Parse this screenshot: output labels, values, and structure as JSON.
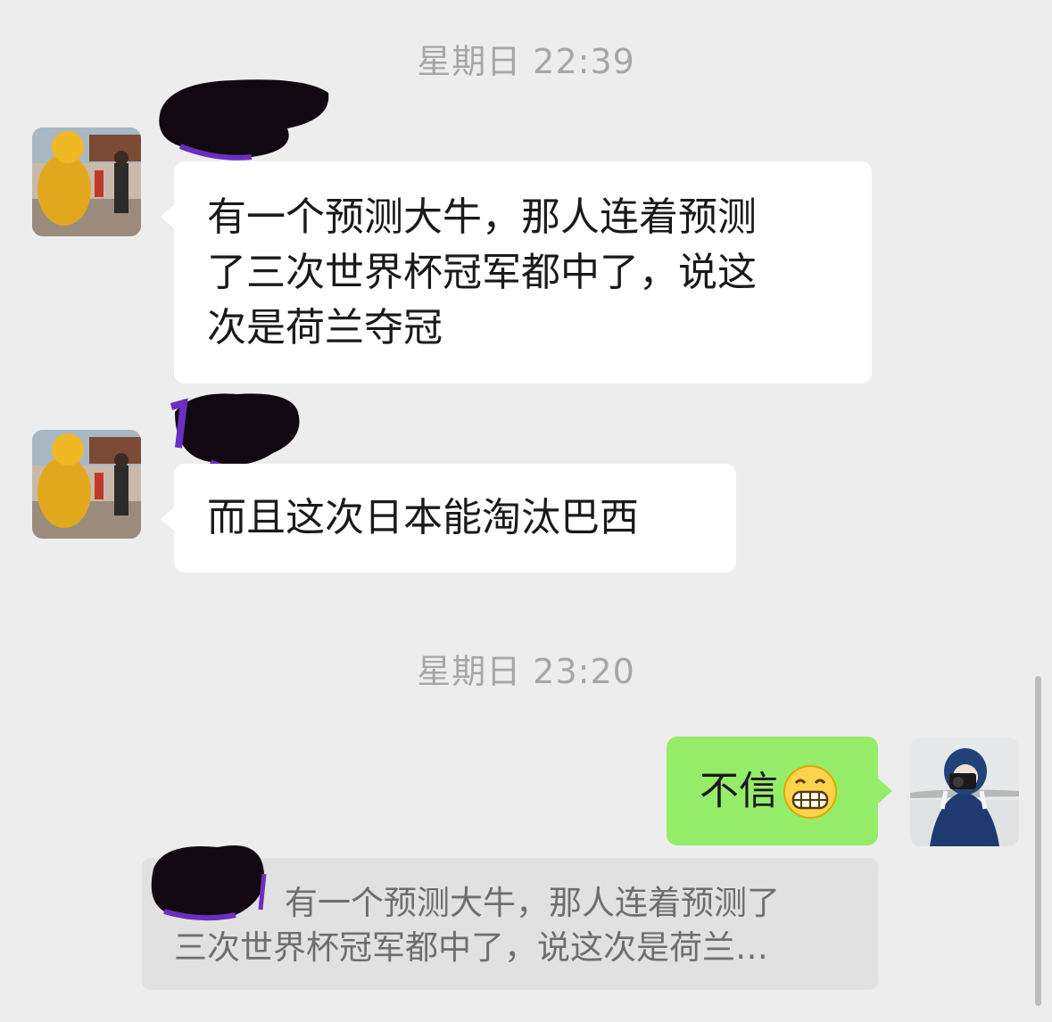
{
  "chat": {
    "timestamps": [
      "星期日 22:39",
      "星期日 23:20"
    ],
    "messages": [
      {
        "side": "left",
        "sender": "redacted",
        "lines": [
          "有一个预测大牛，那人连着预测",
          "了三次世界杯冠军都中了，说这",
          "次是荷兰夺冠"
        ]
      },
      {
        "side": "left",
        "sender": "redacted",
        "text": "而且这次日本能淘汰巴西"
      },
      {
        "side": "right",
        "sender": "me",
        "text": "不信",
        "emoji": "grinning-face"
      }
    ],
    "quote": {
      "lines": [
        "有一个预测大牛，那人连着预测了",
        "三次世界杯冠军都中了，说这次是荷兰…"
      ]
    }
  },
  "colors": {
    "background": "#ededed",
    "incoming_bubble": "#ffffff",
    "outgoing_bubble": "#95ec69",
    "quote_box": "#e1e1e1",
    "timestamp_text": "#a6a6a6"
  }
}
